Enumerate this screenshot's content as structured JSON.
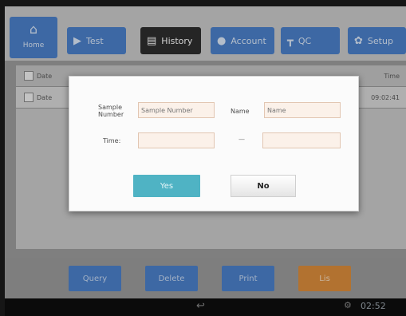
{
  "toolbar": {
    "home_label": "Home",
    "buttons": [
      {
        "label": "Test",
        "icon": "play-icon"
      },
      {
        "label": "History",
        "icon": "history-icon"
      },
      {
        "label": "Account",
        "icon": "account-icon"
      },
      {
        "label": "QC",
        "icon": "qc-icon"
      },
      {
        "label": "Setup",
        "icon": "gear-icon"
      }
    ]
  },
  "table": {
    "header": {
      "col1": "Date",
      "col_last": "Time"
    },
    "rows": [
      {
        "col1": "Date",
        "time": "09:02:41"
      }
    ]
  },
  "dialog": {
    "sample_number_label": "Sample Number",
    "sample_number_placeholder": "Sample Number",
    "name_label": "Name",
    "name_placeholder": "Name",
    "time_label": "Time:",
    "time_separator": "—",
    "yes_label": "Yes",
    "no_label": "No"
  },
  "bottom_bar": {
    "buttons": [
      {
        "label": "Query"
      },
      {
        "label": "Delete"
      },
      {
        "label": "Print"
      },
      {
        "label": "Lis",
        "style": "exit"
      }
    ]
  },
  "navbar": {
    "clock": "02:52"
  },
  "colors": {
    "toolbar_blue": "#4b7fc8",
    "active_tab": "#2e2e2e",
    "yes_button": "#4fb3c4",
    "exit_button": "#d98b3b",
    "input_border": "#e2c6b2"
  }
}
